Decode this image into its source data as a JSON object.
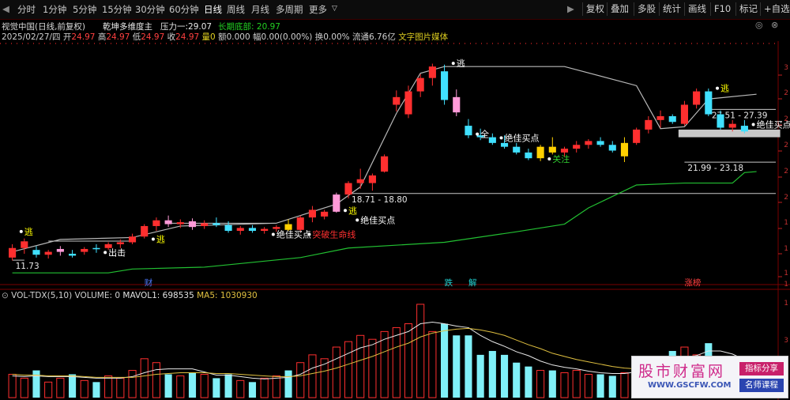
{
  "toolbar": {
    "timeframes": [
      {
        "id": "fenshi",
        "label": "分时"
      },
      {
        "id": "1min",
        "label": "1分钟"
      },
      {
        "id": "5min",
        "label": "5分钟"
      },
      {
        "id": "15min",
        "label": "15分钟"
      },
      {
        "id": "30min",
        "label": "30分钟"
      },
      {
        "id": "60min",
        "label": "60分钟"
      },
      {
        "id": "day",
        "label": "日线"
      },
      {
        "id": "week",
        "label": "周线"
      },
      {
        "id": "month",
        "label": "月线"
      },
      {
        "id": "multi",
        "label": "多周期"
      },
      {
        "id": "more",
        "label": "更多"
      }
    ],
    "active_timeframe": "日线",
    "more_arrow": "▽",
    "right_buttons": [
      {
        "id": "fuquan",
        "label": "复权"
      },
      {
        "id": "diejia",
        "label": "叠加"
      },
      {
        "id": "duogu",
        "label": "多股"
      },
      {
        "id": "tongji",
        "label": "统计"
      },
      {
        "id": "huaxian",
        "label": "画线"
      },
      {
        "id": "f10",
        "label": "F10"
      },
      {
        "id": "biaoji",
        "label": "标记"
      },
      {
        "id": "zixuan",
        "label": "+自选"
      }
    ],
    "nav_left": "◀",
    "nav_right": "▶"
  },
  "header": {
    "stock": "视觉中国(日线,前复权)",
    "indicator": "乾坤多维度主",
    "pressure_label": "压力一:",
    "pressure_value": "29.07",
    "support_label": "长期底部:",
    "support_value": "20.97"
  },
  "quote": {
    "date": "2025/02/27/四",
    "open_label": "开",
    "open": "24.97",
    "high_label": "高",
    "high": "24.97",
    "low_label": "低",
    "low": "24.97",
    "close_label": "收",
    "close": "24.97",
    "vol_label": "量",
    "vol": "0",
    "amount_label": "额",
    "amount": "0.000",
    "change_label": "幅",
    "change": "0.00(0.00%)",
    "turnover_label": "换",
    "turnover": "0.00%",
    "float_label": "流通",
    "float": "6.76亿",
    "media": "文字图片媒体"
  },
  "chart_data": {
    "type": "candlestick",
    "x_count": 62,
    "price_range": [
      10.0,
      34.0
    ],
    "candles": [
      {
        "o": 12.0,
        "h": 13.4,
        "l": 11.7,
        "c": 13.0
      },
      {
        "o": 13.0,
        "h": 14.0,
        "l": 12.4,
        "c": 13.7
      },
      {
        "o": 12.8,
        "h": 13.2,
        "l": 12.0,
        "c": 12.3
      },
      {
        "o": 12.3,
        "h": 12.8,
        "l": 11.9,
        "c": 12.6
      },
      {
        "o": 12.6,
        "h": 13.2,
        "l": 12.2,
        "c": 12.9
      },
      {
        "o": 12.4,
        "h": 12.8,
        "l": 12.0,
        "c": 12.2
      },
      {
        "o": 12.6,
        "h": 13.1,
        "l": 12.3,
        "c": 12.9
      },
      {
        "o": 13.0,
        "h": 13.4,
        "l": 12.5,
        "c": 12.9
      },
      {
        "o": 13.0,
        "h": 13.6,
        "l": 12.8,
        "c": 13.4
      },
      {
        "o": 13.4,
        "h": 13.9,
        "l": 13.0,
        "c": 13.6
      },
      {
        "o": 13.6,
        "h": 14.5,
        "l": 13.4,
        "c": 14.2
      },
      {
        "o": 14.2,
        "h": 15.5,
        "l": 14.0,
        "c": 15.3
      },
      {
        "o": 15.3,
        "h": 16.2,
        "l": 14.8,
        "c": 15.9
      },
      {
        "o": 15.9,
        "h": 16.4,
        "l": 15.2,
        "c": 15.5
      },
      {
        "o": 15.5,
        "h": 16.0,
        "l": 15.1,
        "c": 15.7
      },
      {
        "o": 15.8,
        "h": 16.1,
        "l": 14.9,
        "c": 15.2
      },
      {
        "o": 15.3,
        "h": 15.9,
        "l": 15.0,
        "c": 15.6
      },
      {
        "o": 15.6,
        "h": 16.2,
        "l": 15.2,
        "c": 15.4
      },
      {
        "o": 15.4,
        "h": 15.8,
        "l": 14.6,
        "c": 14.8
      },
      {
        "o": 14.8,
        "h": 15.3,
        "l": 14.4,
        "c": 15.1
      },
      {
        "o": 15.1,
        "h": 15.4,
        "l": 14.6,
        "c": 14.8
      },
      {
        "o": 14.8,
        "h": 15.2,
        "l": 14.5,
        "c": 15.0
      },
      {
        "o": 15.0,
        "h": 15.4,
        "l": 14.7,
        "c": 15.2
      },
      {
        "o": 15.5,
        "h": 16.0,
        "l": 14.8,
        "c": 14.9
      },
      {
        "o": 14.9,
        "h": 16.4,
        "l": 14.7,
        "c": 16.2
      },
      {
        "o": 16.2,
        "h": 17.4,
        "l": 15.7,
        "c": 17.0
      },
      {
        "o": 16.3,
        "h": 17.0,
        "l": 16.0,
        "c": 16.8
      },
      {
        "o": 16.8,
        "h": 18.8,
        "l": 16.7,
        "c": 18.6
      },
      {
        "o": 18.6,
        "h": 20.0,
        "l": 18.2,
        "c": 19.8
      },
      {
        "o": 19.8,
        "h": 21.3,
        "l": 19.2,
        "c": 20.2
      },
      {
        "o": 19.8,
        "h": 20.8,
        "l": 19.0,
        "c": 20.6
      },
      {
        "o": 21.0,
        "h": 22.8,
        "l": 20.9,
        "c": 22.6
      },
      {
        "o": 28.0,
        "h": 29.5,
        "l": 27.3,
        "c": 28.8
      },
      {
        "o": 27.0,
        "h": 30.0,
        "l": 26.6,
        "c": 29.4
      },
      {
        "o": 29.4,
        "h": 31.2,
        "l": 28.8,
        "c": 30.8
      },
      {
        "o": 30.8,
        "h": 32.3,
        "l": 30.0,
        "c": 32.0
      },
      {
        "o": 31.5,
        "h": 32.2,
        "l": 28.0,
        "c": 28.5
      },
      {
        "o": 28.8,
        "h": 29.6,
        "l": 26.8,
        "c": 27.2
      },
      {
        "o": 25.8,
        "h": 26.5,
        "l": 24.5,
        "c": 24.8
      },
      {
        "o": 24.8,
        "h": 25.5,
        "l": 24.3,
        "c": 24.6
      },
      {
        "o": 24.6,
        "h": 25.0,
        "l": 23.8,
        "c": 24.0
      },
      {
        "o": 24.0,
        "h": 24.8,
        "l": 23.4,
        "c": 23.6
      },
      {
        "o": 23.6,
        "h": 24.0,
        "l": 22.8,
        "c": 23.0
      },
      {
        "o": 23.0,
        "h": 23.4,
        "l": 22.2,
        "c": 22.4
      },
      {
        "o": 22.4,
        "h": 23.8,
        "l": 22.1,
        "c": 23.6
      },
      {
        "o": 23.6,
        "h": 24.6,
        "l": 22.8,
        "c": 23.0
      },
      {
        "o": 23.0,
        "h": 23.6,
        "l": 22.6,
        "c": 23.4
      },
      {
        "o": 23.4,
        "h": 24.2,
        "l": 23.0,
        "c": 23.8
      },
      {
        "o": 23.8,
        "h": 24.4,
        "l": 23.4,
        "c": 24.2
      },
      {
        "o": 24.2,
        "h": 24.6,
        "l": 23.6,
        "c": 23.8
      },
      {
        "o": 23.8,
        "h": 24.2,
        "l": 23.0,
        "c": 23.2
      },
      {
        "o": 22.6,
        "h": 24.6,
        "l": 22.0,
        "c": 24.0
      },
      {
        "o": 24.0,
        "h": 25.6,
        "l": 23.8,
        "c": 25.4
      },
      {
        "o": 25.4,
        "h": 26.8,
        "l": 25.0,
        "c": 26.4
      },
      {
        "o": 26.4,
        "h": 27.4,
        "l": 25.6,
        "c": 26.8
      },
      {
        "o": 26.8,
        "h": 27.0,
        "l": 26.0,
        "c": 26.2
      },
      {
        "o": 26.0,
        "h": 28.4,
        "l": 25.8,
        "c": 28.0
      },
      {
        "o": 28.0,
        "h": 29.7,
        "l": 27.6,
        "c": 29.4
      },
      {
        "o": 29.4,
        "h": 29.7,
        "l": 26.8,
        "c": 27.0
      },
      {
        "o": 27.0,
        "h": 27.4,
        "l": 25.4,
        "c": 25.6
      },
      {
        "o": 25.6,
        "h": 26.4,
        "l": 25.2,
        "c": 26.0
      },
      {
        "o": 25.8,
        "h": 26.4,
        "l": 25.0,
        "c": 25.2
      }
    ],
    "pressure_line": [
      [
        0,
        12.6
      ],
      [
        4,
        13.9
      ],
      [
        10,
        14.1
      ],
      [
        14,
        15.3
      ],
      [
        22,
        15.6
      ],
      [
        27,
        17.6
      ],
      [
        29,
        19.4
      ],
      [
        32,
        27.1
      ],
      [
        34,
        31.3
      ],
      [
        36,
        32.0
      ],
      [
        46,
        32.0
      ],
      [
        52,
        30.0
      ],
      [
        54,
        25.5
      ],
      [
        55,
        25.6
      ],
      [
        56,
        25.7
      ],
      [
        58,
        28.6
      ],
      [
        62,
        29.1
      ]
    ],
    "support_line": [
      [
        0,
        10.4
      ],
      [
        8,
        10.4
      ],
      [
        10,
        10.8
      ],
      [
        16,
        11.0
      ],
      [
        24,
        12.0
      ],
      [
        28,
        13.0
      ],
      [
        36,
        13.6
      ],
      [
        42,
        14.7
      ],
      [
        46,
        15.5
      ],
      [
        48,
        17.2
      ],
      [
        52,
        19.6
      ],
      [
        56,
        19.8
      ],
      [
        60,
        19.8
      ],
      [
        61,
        20.9
      ],
      [
        62,
        21.0
      ]
    ],
    "zones": [
      {
        "from": 56,
        "to": 62,
        "low": 24.6,
        "high": 25.4
      }
    ],
    "horizontal_levels": [
      {
        "value": 11.73,
        "label": "11.73",
        "from": 0,
        "to": 1
      },
      {
        "value": 13.72,
        "from": 3,
        "to": 10
      },
      {
        "value": 15.6,
        "from": 13,
        "to": 22
      },
      {
        "value": 18.71,
        "label": "18.71 - 18.80",
        "from": 28,
        "to": 62
      },
      {
        "value": 21.99,
        "label": "21.99 - 23.18",
        "from": 56,
        "to": 62
      },
      {
        "value": 27.51,
        "label": "27.51 - 27.39",
        "from": 58,
        "to": 62
      }
    ],
    "signals": [
      {
        "i": 1,
        "text": "逃",
        "price": 14.4,
        "color": "#ffff00"
      },
      {
        "i": 8,
        "text": "出击",
        "price": 12.2,
        "color": "#ffffff"
      },
      {
        "i": 12,
        "text": "逃",
        "price": 13.6,
        "color": "#ffff00"
      },
      {
        "i": 22,
        "text": "绝佳买点",
        "price": 14.1,
        "color": "#ffffff"
      },
      {
        "i": 25,
        "text": "突破生命线",
        "price": 14.1,
        "color": "#ff3030"
      },
      {
        "i": 28,
        "text": "逃",
        "price": 16.6,
        "color": "#ffff00"
      },
      {
        "i": 29,
        "text": "绝佳买点",
        "price": 15.6,
        "color": "#ffffff"
      },
      {
        "i": 37,
        "text": "逃",
        "price": 32.0,
        "color": "#ffffff"
      },
      {
        "i": 39,
        "text": "全",
        "price": 24.6,
        "color": "#ffffff"
      },
      {
        "i": 41,
        "text": "绝佳买点",
        "price": 24.2,
        "color": "#ffffff"
      },
      {
        "i": 45,
        "text": "关注",
        "price": 22.0,
        "color": "#30d030"
      },
      {
        "i": 59,
        "text": "逃",
        "price": 29.4,
        "color": "#ffff00"
      },
      {
        "i": 62,
        "text": "绝佳买点",
        "price": 25.6,
        "color": "#ffffff"
      }
    ],
    "bottom_markers": [
      {
        "i": 11,
        "text": "财",
        "color": "#4a78ff"
      },
      {
        "i": 36,
        "text": "跌",
        "color": "#20d0d0"
      },
      {
        "i": 38,
        "text": "解",
        "color": "#20d0d0"
      },
      {
        "i": 56,
        "text": "涨榜",
        "color": "#ff4040"
      }
    ],
    "volume": {
      "indicator": "VOL-TDX(5,10)",
      "vol_label": "VOLUME:",
      "vol_value": "0",
      "mavol1_label": "MAVOL1:",
      "mavol1_value": "698535",
      "ma5_label": "MA5:",
      "ma5_value": "1030930",
      "values": [
        0.3,
        0.25,
        0.35,
        0.2,
        0.25,
        0.3,
        0.22,
        0.2,
        0.28,
        0.25,
        0.35,
        0.5,
        0.45,
        0.3,
        0.28,
        0.32,
        0.3,
        0.25,
        0.3,
        0.22,
        0.2,
        0.25,
        0.28,
        0.35,
        0.45,
        0.55,
        0.5,
        0.65,
        0.72,
        0.8,
        0.75,
        0.85,
        0.9,
        0.95,
        1.2,
        0.85,
        0.95,
        0.8,
        0.8,
        0.55,
        0.6,
        0.55,
        0.45,
        0.4,
        0.35,
        0.35,
        0.32,
        0.35,
        0.3,
        0.3,
        0.28,
        0.32,
        0.45,
        0.4,
        0.48,
        0.6,
        0.65,
        0.55,
        0.7,
        0.5,
        0.4,
        0.3
      ],
      "ma5": [
        0.28,
        0.27,
        0.28,
        0.27,
        0.27,
        0.27,
        0.26,
        0.25,
        0.25,
        0.25,
        0.27,
        0.32,
        0.36,
        0.37,
        0.37,
        0.37,
        0.33,
        0.29,
        0.29,
        0.27,
        0.25,
        0.24,
        0.25,
        0.26,
        0.3,
        0.38,
        0.43,
        0.5,
        0.57,
        0.64,
        0.68,
        0.75,
        0.8,
        0.85,
        0.95,
        0.97,
        0.95,
        0.92,
        0.9,
        0.8,
        0.72,
        0.66,
        0.59,
        0.54,
        0.47,
        0.42,
        0.39,
        0.37,
        0.34,
        0.32,
        0.31,
        0.31,
        0.33,
        0.35,
        0.39,
        0.45,
        0.52,
        0.54,
        0.6,
        0.6,
        0.56,
        0.49
      ],
      "ma10": [
        0.3,
        0.29,
        0.29,
        0.28,
        0.28,
        0.28,
        0.27,
        0.26,
        0.26,
        0.26,
        0.26,
        0.28,
        0.3,
        0.31,
        0.32,
        0.32,
        0.32,
        0.31,
        0.31,
        0.3,
        0.29,
        0.28,
        0.27,
        0.27,
        0.28,
        0.31,
        0.34,
        0.38,
        0.43,
        0.48,
        0.53,
        0.59,
        0.65,
        0.7,
        0.78,
        0.83,
        0.86,
        0.88,
        0.89,
        0.87,
        0.84,
        0.8,
        0.74,
        0.68,
        0.63,
        0.57,
        0.53,
        0.49,
        0.46,
        0.43,
        0.4,
        0.38,
        0.37,
        0.37,
        0.38,
        0.4,
        0.43,
        0.45,
        0.48,
        0.5,
        0.5,
        0.49
      ]
    },
    "axis": {
      "labels": [
        "3",
        "2",
        "2",
        "2",
        "2",
        "2",
        "1",
        "1",
        "1",
        "1",
        "1",
        "3",
        "2",
        "1"
      ]
    }
  },
  "watermark": {
    "title": "股市财富网",
    "url": "WWW.GSCFW.COM",
    "badge1": "指标分享",
    "badge2": "名师课程"
  },
  "colors": {
    "up": "#ff2f2f",
    "down": "#40e0ff",
    "pressure": "#b8b8b8",
    "support": "#22c032",
    "zone": "#c8c8c8",
    "vol_ma5": "#e8e8e8",
    "vol_ma10": "#e0c040"
  }
}
